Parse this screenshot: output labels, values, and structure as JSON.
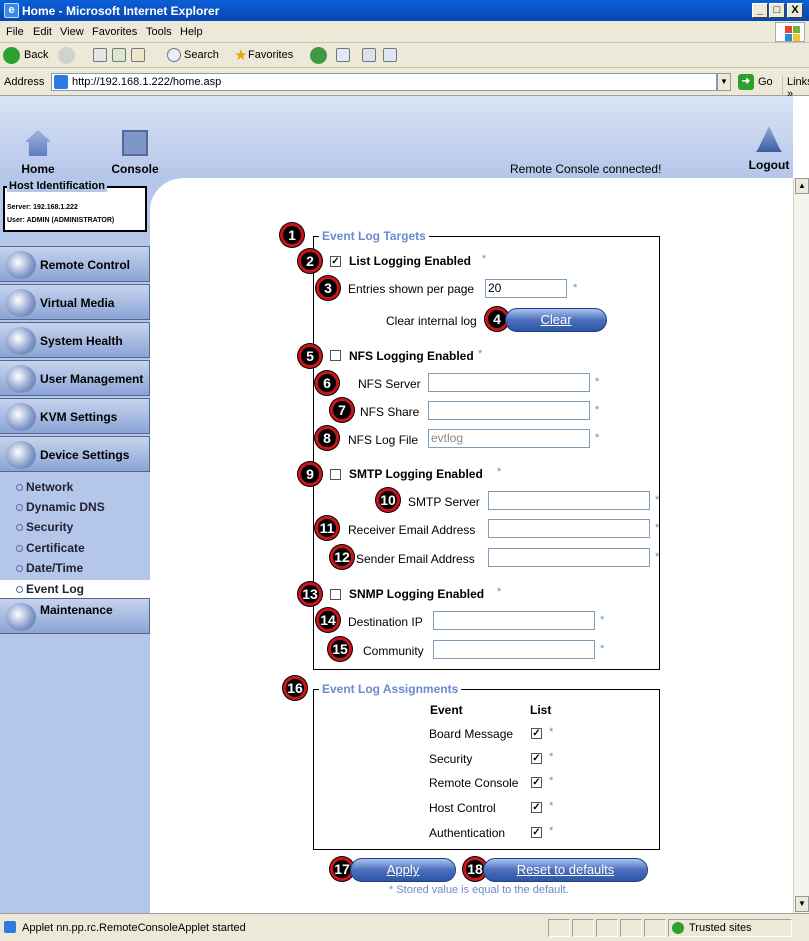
{
  "window": {
    "title": "Home - Microsoft Internet Explorer",
    "min": "_",
    "max": "□",
    "close": "X"
  },
  "menu": [
    "File",
    "Edit",
    "View",
    "Favorites",
    "Tools",
    "Help"
  ],
  "toolbar": {
    "back": "Back",
    "search": "Search",
    "favorites": "Favorites"
  },
  "address": {
    "label": "Address",
    "url": "http://192.168.1.222/home.asp",
    "go": "Go",
    "links": "Links"
  },
  "topnav": {
    "home": "Home",
    "console": "Console",
    "logout": "Logout",
    "status": "Remote Console connected!"
  },
  "host": {
    "title": "Host Identification",
    "server": "Server: 192.168.1.222",
    "user": "User: ADMIN (ADMINISTRATOR)"
  },
  "sidebar": {
    "items": [
      "Remote Control",
      "Virtual Media",
      "System Health",
      "User Management",
      "KVM Settings",
      "Device Settings"
    ],
    "sub": [
      "Network",
      "Dynamic DNS",
      "Security",
      "Certificate",
      "Date/Time",
      "Event Log"
    ],
    "maintenance": "Maintenance"
  },
  "targets": {
    "legend": "Event Log Targets",
    "list_enabled": "List Logging Enabled",
    "entries_label": "Entries shown per page",
    "entries_value": "20",
    "clear_label": "Clear internal log",
    "clear_btn": "Clear",
    "nfs_enabled": "NFS Logging Enabled",
    "nfs_server": "NFS Server",
    "nfs_share": "NFS Share",
    "nfs_logfile": "NFS Log File",
    "nfs_logfile_value": "evtlog",
    "smtp_enabled": "SMTP Logging Enabled",
    "smtp_server": "SMTP Server",
    "receiver": "Receiver Email Address",
    "sender": "Sender Email Address",
    "snmp_enabled": "SNMP Logging Enabled",
    "dest_ip": "Destination IP",
    "community": "Community"
  },
  "assign": {
    "legend": "Event Log Assignments",
    "col_event": "Event",
    "col_list": "List",
    "rows": [
      "Board Message",
      "Security",
      "Remote Console",
      "Host Control",
      "Authentication"
    ]
  },
  "buttons": {
    "apply": "Apply",
    "reset": "Reset to defaults"
  },
  "note": "* Stored value is equal to the default.",
  "star": "*",
  "check": "✓",
  "badges": [
    "1",
    "2",
    "3",
    "4",
    "5",
    "6",
    "7",
    "8",
    "9",
    "10",
    "11",
    "12",
    "13",
    "14",
    "15",
    "16",
    "17",
    "18"
  ],
  "statusbar": {
    "text": "Applet nn.pp.rc.RemoteConsoleApplet started",
    "zone": "Trusted sites"
  },
  "colors": {
    "accent": "#6a8ad0",
    "sidebar": "#b4c6e9",
    "badge_ring": "#c8151b"
  }
}
